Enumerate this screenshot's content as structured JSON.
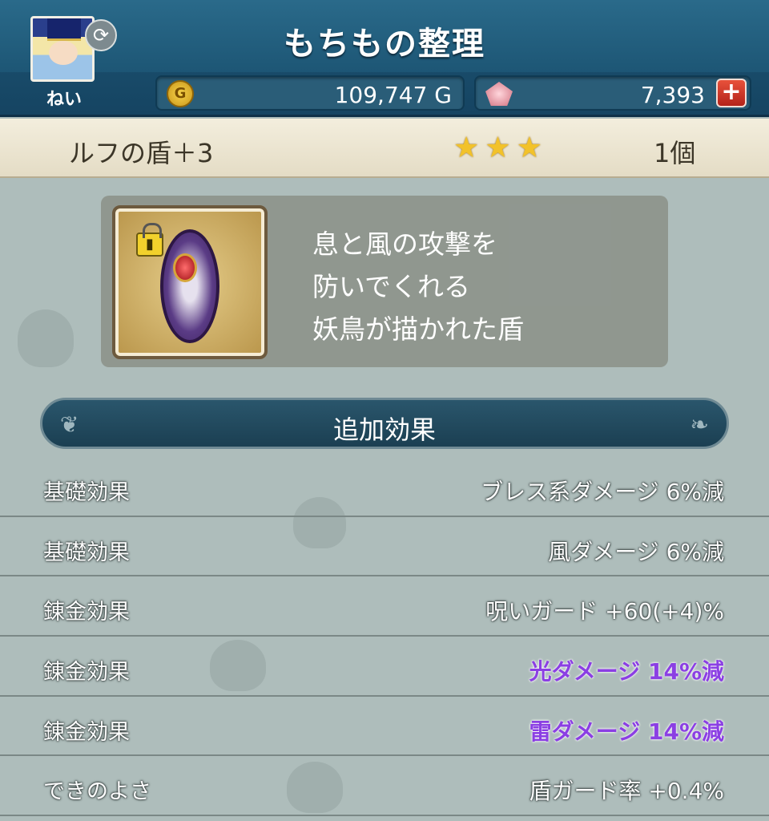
{
  "header": {
    "title": "もちもの整理",
    "character_name": "ねい",
    "gold_value": "109,747 G",
    "gem_value": "7,393",
    "add_label": "+"
  },
  "item": {
    "name": "ルフの盾＋3",
    "stars": [
      "★",
      "★",
      "★"
    ],
    "count": "1個",
    "description": [
      "息と風の攻撃を",
      "防いでくれる",
      "妖鳥が描かれた盾"
    ]
  },
  "section": {
    "title": "追加効果"
  },
  "effects": [
    {
      "label": "基礎効果",
      "value": "ブレス系ダメージ 6%減",
      "highlight": false
    },
    {
      "label": "基礎効果",
      "value": "風ダメージ 6%減",
      "highlight": false
    },
    {
      "label": "錬金効果",
      "value": "呪いガード +60(+4)%",
      "highlight": false
    },
    {
      "label": "錬金効果",
      "value": "光ダメージ 14%減",
      "highlight": true
    },
    {
      "label": "錬金効果",
      "value": "雷ダメージ 14%減",
      "highlight": true
    },
    {
      "label": "できのよさ",
      "value": "盾ガード率 +0.4%",
      "highlight": false
    }
  ],
  "colors": {
    "header": "#1d5675",
    "star": "#f2c22a",
    "highlight": "#8b3fe3",
    "add_button": "#d2392a"
  },
  "icons": {
    "swap": "swap-icon",
    "gold": "gold-coin-icon",
    "gem": "gem-icon",
    "add": "add-icon",
    "lock": "lock-icon"
  }
}
